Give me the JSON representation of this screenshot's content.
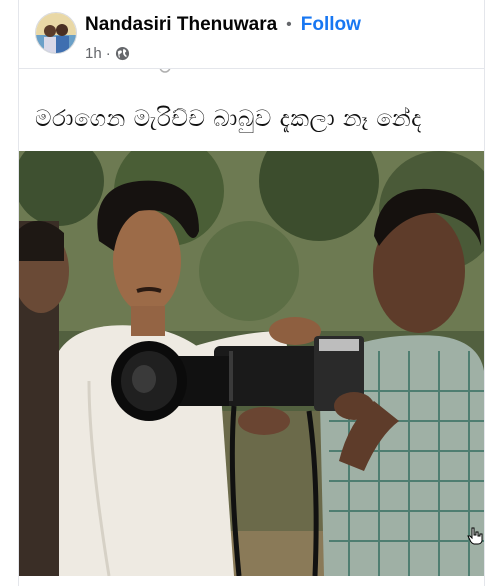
{
  "post": {
    "author": "Nandasiri Thenuwara",
    "separator": "•",
    "follow_label": "Follow",
    "time": "1h",
    "meta_separator": "·",
    "privacy_icon": "globe-icon",
    "caption": "මරාගෙන මැරිච්ච බාබුව දැකලා නෑ නේද"
  },
  "colors": {
    "follow": "#1877f2",
    "name": "#050505",
    "meta": "#65676b"
  },
  "photo": {
    "icon": "photo-image"
  }
}
